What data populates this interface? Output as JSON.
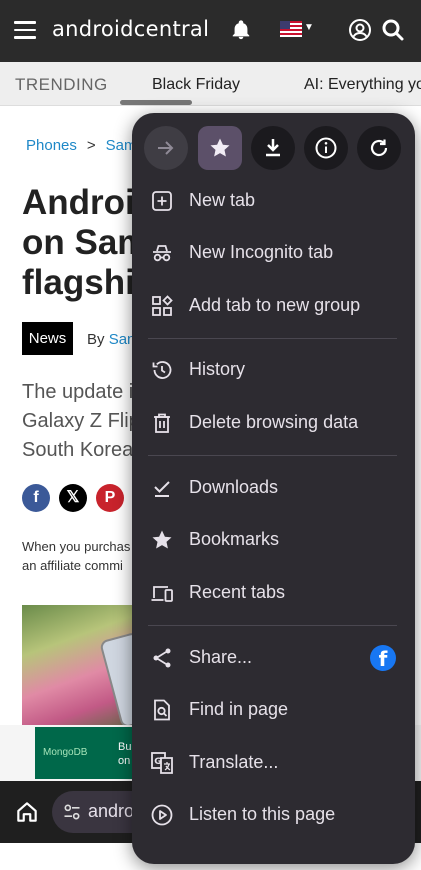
{
  "site": {
    "brand": "androidcentral",
    "trending_label": "TRENDING",
    "trending_items": [
      "Black Friday",
      "AI: Everything you"
    ]
  },
  "article": {
    "breadcrumb": [
      "Phones",
      "Sam"
    ],
    "headline_lines": [
      "Androi",
      "on Sam",
      "flagshi"
    ],
    "tag": "News",
    "by": "By",
    "author": "San",
    "deck_lines": [
      "The update i",
      "Galaxy Z Flip",
      "South Korea"
    ],
    "disclaimer_lines": [
      "When you purchas",
      "an affiliate commi"
    ]
  },
  "ad": {
    "brand": "MongoDB",
    "copy_lines": [
      "Bu",
      "on"
    ]
  },
  "browser": {
    "omnibox_text": "andro"
  },
  "menu": {
    "toolbar": [
      {
        "name": "forward",
        "icon": "arrow-forward-icon",
        "enabled": false
      },
      {
        "name": "bookmark",
        "icon": "star-icon",
        "active": true
      },
      {
        "name": "download",
        "icon": "download-icon"
      },
      {
        "name": "page-info",
        "icon": "info-icon"
      },
      {
        "name": "reload",
        "icon": "reload-icon"
      }
    ],
    "items": [
      {
        "label": "New tab",
        "icon": "add-box-icon"
      },
      {
        "label": "New Incognito tab",
        "icon": "incognito-icon"
      },
      {
        "label": "Add tab to new group",
        "icon": "tab-group-icon"
      },
      {
        "label": "History",
        "icon": "history-icon"
      },
      {
        "label": "Delete browsing data",
        "icon": "trash-icon"
      },
      {
        "label": "Downloads",
        "icon": "downloads-check-icon"
      },
      {
        "label": "Bookmarks",
        "icon": "star-icon"
      },
      {
        "label": "Recent tabs",
        "icon": "devices-icon"
      },
      {
        "label": "Share...",
        "icon": "share-icon"
      },
      {
        "label": "Find in page",
        "icon": "find-in-page-icon"
      },
      {
        "label": "Translate...",
        "icon": "translate-icon"
      },
      {
        "label": "Listen to this page",
        "icon": "play-circle-icon"
      }
    ]
  },
  "colors": {
    "menu_bg": "#2d2b31",
    "menu_text": "#e6e1e9",
    "header_bg": "#2b2b2b",
    "link": "#1e88c7",
    "facebook": "#1877f2"
  }
}
